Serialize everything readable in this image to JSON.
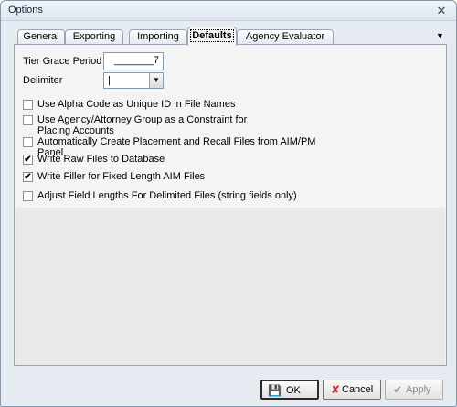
{
  "window": {
    "title": "Options",
    "close_glyph": "✕"
  },
  "tabs": [
    {
      "label": "General",
      "active": false
    },
    {
      "label": "Exporting",
      "active": false
    },
    {
      "label": "Importing",
      "active": false
    },
    {
      "label": "Defaults",
      "active": true
    },
    {
      "label": "Agency Evaluator",
      "active": false
    }
  ],
  "tab_overflow_glyph": "▼",
  "fields": {
    "tier_grace_period": {
      "label": "Tier Grace Period",
      "value": "_______7"
    },
    "delimiter": {
      "label": "Delimiter",
      "value": "|",
      "dropdown_glyph": "▼"
    }
  },
  "checkboxes": [
    {
      "label": "Use Alpha Code as Unique ID in File Names",
      "checked": false
    },
    {
      "label": "Use Agency/Attorney Group as a Constraint for Placing Accounts",
      "checked": false
    },
    {
      "label": "Automatically Create Placement and Recall Files from AIM/PM Panel",
      "checked": false
    },
    {
      "label": "Write Raw Files to Database",
      "checked": true
    },
    {
      "label": "Write Filler for Fixed Length AIM Files",
      "checked": true
    },
    {
      "label": "Adjust Field Lengths For Delimited Files (string fields only)",
      "checked": false
    }
  ],
  "check_glyph": "✔",
  "buttons": {
    "ok": {
      "label": "OK",
      "icon": "save-disk-icon",
      "glyph": "💾",
      "color": "#1f5fbf"
    },
    "cancel": {
      "label": "Cancel",
      "icon": "red-x-icon",
      "glyph": "✘",
      "color": "#d02020"
    },
    "apply": {
      "label": "Apply",
      "icon": "checkmark-icon",
      "glyph": "✔",
      "color": "#9a9a9a",
      "enabled": false
    }
  }
}
